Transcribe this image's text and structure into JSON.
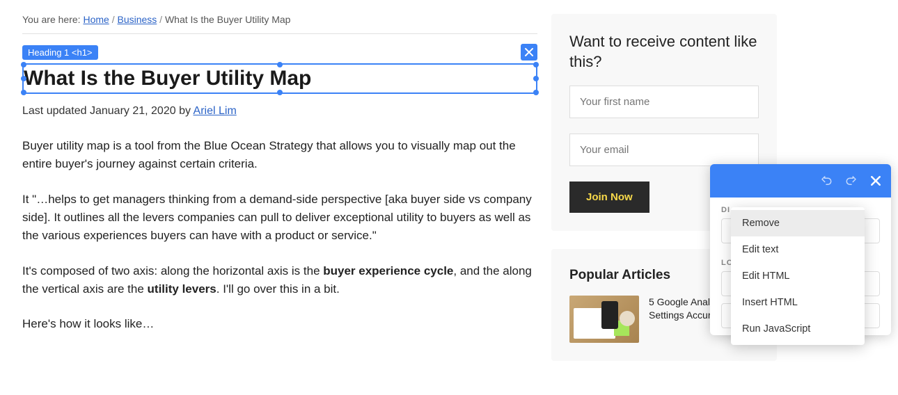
{
  "breadcrumb": {
    "prefix": "You are here: ",
    "home": "Home",
    "section": "Business",
    "current": "What Is the Buyer Utility Map",
    "sep": " / "
  },
  "selection": {
    "label": "Heading 1 <h1>",
    "heading": "What Is the Buyer Utility Map"
  },
  "meta": {
    "updated_prefix": "Last updated ",
    "date": "January 21, 2020",
    "by": " by ",
    "author": "Ariel Lim"
  },
  "content": {
    "p1": "Buyer utility map is a tool from the Blue Ocean Strategy that allows you to visually map out the entire buyer's journey against certain criteria.",
    "p2": "It \"…helps to get managers thinking from a demand-side perspective [aka buyer side vs company side]. It outlines all the levers companies can pull to deliver exceptional utility to buyers as well as the various experiences buyers can have with a product or service.\"",
    "p3_a": "It's composed of two axis: along the horizontal axis is the ",
    "p3_b1": "buyer experience cycle",
    "p3_c": ", and the along the vertical axis are the ",
    "p3_b2": "utility levers",
    "p3_d": ". I'll go over this in a bit.",
    "p4": "Here's how it looks like…"
  },
  "subscribe": {
    "title": "Want to receive content like this?",
    "first_name_placeholder": "Your first name",
    "email_placeholder": "Your email",
    "button": "Join Now"
  },
  "popular": {
    "title": "Popular Articles",
    "item1_title": "5 Google Analytics Settings Accura and Re"
  },
  "editor": {
    "section_di": "DI",
    "section_lo": "LO",
    "menu": {
      "remove": "Remove",
      "edit_text": "Edit text",
      "edit_html": "Edit HTML",
      "insert_html": "Insert HTML",
      "run_js": "Run JavaScript"
    }
  }
}
